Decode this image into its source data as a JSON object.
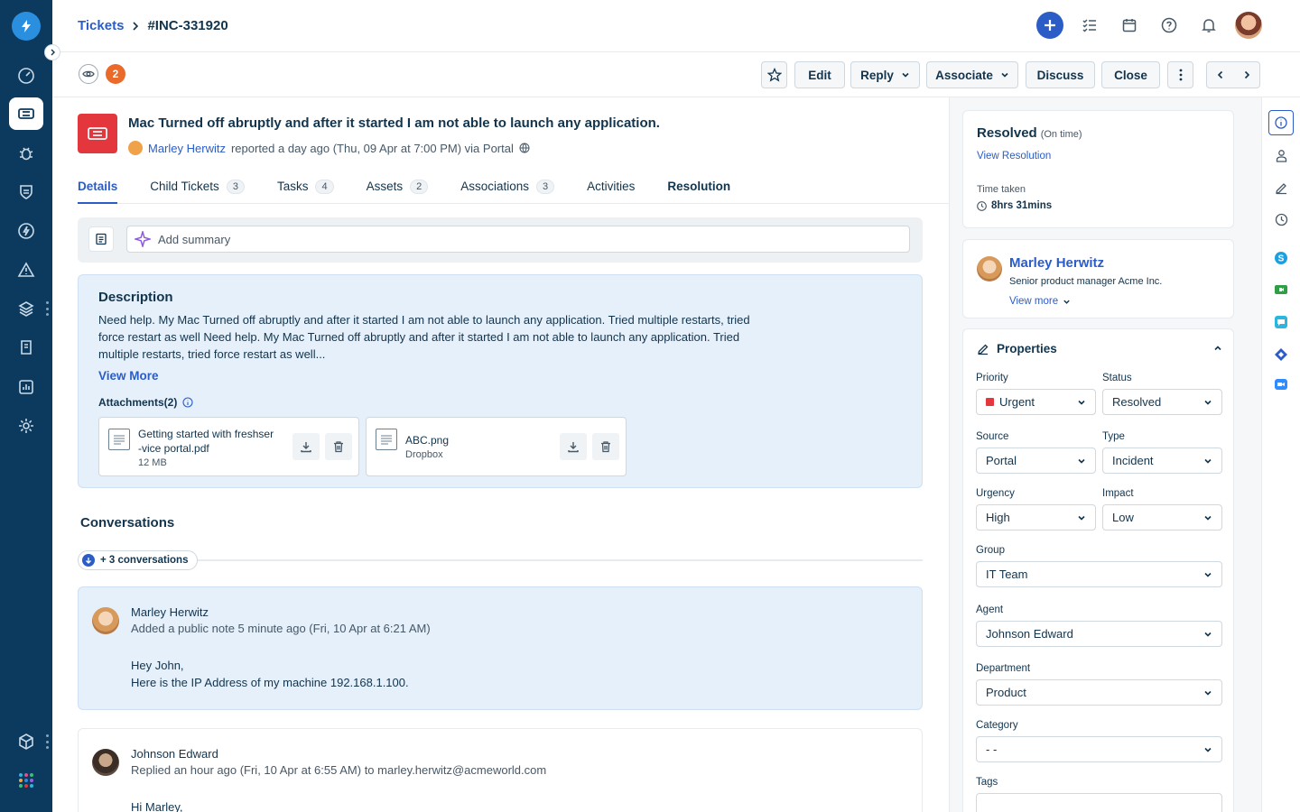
{
  "breadcrumb": {
    "parent": "Tickets",
    "current": "#INC-331920"
  },
  "watch_count": "2",
  "actions": {
    "edit": "Edit",
    "reply": "Reply",
    "associate": "Associate",
    "discuss": "Discuss",
    "close": "Close"
  },
  "ticket": {
    "title": "Mac Turned off abruptly and after it started I am not able to launch any application.",
    "requester": "Marley Herwitz",
    "meta": "reported a day ago (Thu, 09 Apr at 7:00 PM) via Portal"
  },
  "tabs": [
    {
      "label": "Details",
      "count": ""
    },
    {
      "label": "Child Tickets",
      "count": "3"
    },
    {
      "label": "Tasks",
      "count": "4"
    },
    {
      "label": "Assets",
      "count": "2"
    },
    {
      "label": "Associations",
      "count": "3"
    },
    {
      "label": "Activities",
      "count": ""
    },
    {
      "label": "Resolution",
      "count": ""
    }
  ],
  "summary": {
    "placeholder": "Add summary"
  },
  "description": {
    "heading": "Description",
    "text": "Need help. My Mac Turned off abruptly and after it started I am not able to launch any application. Tried multiple restarts, tried force restart as well Need help. My Mac Turned off abruptly and after it started I am not able to launch any application. Tried multiple restarts, tried force restart as well...",
    "view_more": "View More",
    "attachments_label": "Attachments(2)",
    "attachments": [
      {
        "name_line1": "Getting started with freshser",
        "name_line2": "-vice portal.pdf",
        "meta": "12 MB"
      },
      {
        "name_line1": "ABC.png",
        "name_line2": "",
        "meta": "Dropbox"
      }
    ]
  },
  "conversations": {
    "heading": "Conversations",
    "more": "+ 3 conversations",
    "items": [
      {
        "author": "Marley Herwitz",
        "sub": "Added a public note 5 minute ago (Fri, 10 Apr at 6:21 AM)",
        "line1": "Hey John,",
        "line2": "Here is the IP Address of my machine 192.168.1.100."
      },
      {
        "author": "Johnson Edward",
        "sub": "Replied an hour ago (Fri, 10 Apr at 6:55 AM) to marley.herwitz@acmeworld.com",
        "line1": "Hi Marley,",
        "line2": ""
      }
    ]
  },
  "status_card": {
    "status": "Resolved",
    "timing": "(On time)",
    "view_resolution": "View Resolution",
    "time_taken_label": "Time taken",
    "time_taken": "8hrs 31mins"
  },
  "requester_card": {
    "name": "Marley Herwitz",
    "role": "Senior product manager Acme Inc.",
    "view_more": "View more"
  },
  "properties": {
    "heading": "Properties",
    "priority_label": "Priority",
    "priority": "Urgent",
    "status_label": "Status",
    "status": "Resolved",
    "source_label": "Source",
    "source": "Portal",
    "type_label": "Type",
    "type": "Incident",
    "urgency_label": "Urgency",
    "urgency": "High",
    "impact_label": "Impact",
    "impact": "Low",
    "group_label": "Group",
    "group": "IT Team",
    "agent_label": "Agent",
    "agent": "Johnson Edward",
    "department_label": "Department",
    "department": "Product",
    "category_label": "Category",
    "category": "- -",
    "tags_label": "Tags"
  },
  "colors": {
    "brand_blue": "#2c5cc5",
    "nav_bg": "#0b3a5e",
    "urgent_red": "#e3363d",
    "badge_orange": "#ea6a2a",
    "note_bg": "#e5f0fb"
  }
}
